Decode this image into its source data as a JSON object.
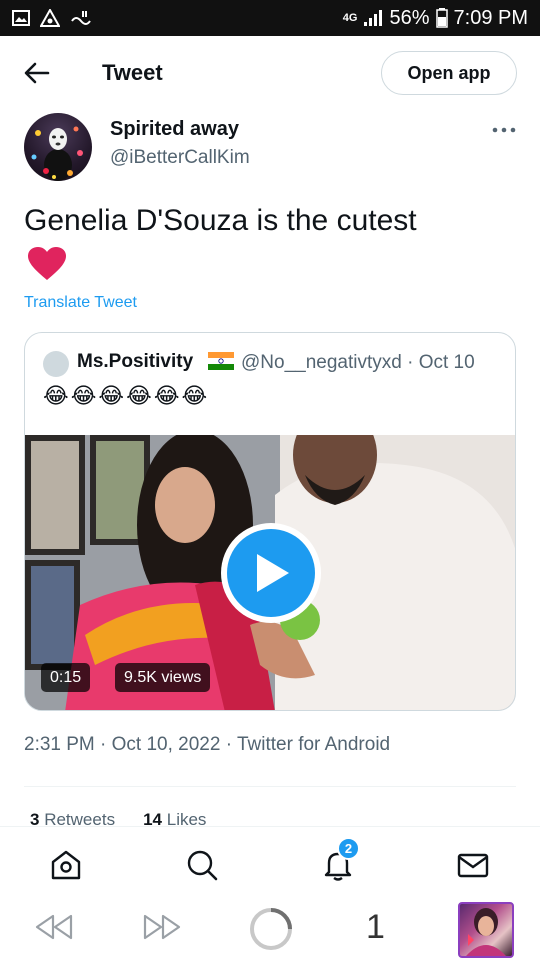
{
  "status_bar": {
    "network": "4G",
    "battery": "56%",
    "time": "7:09 PM"
  },
  "header": {
    "title": "Tweet",
    "open_app_label": "Open app"
  },
  "author": {
    "name": "Spirited away",
    "handle": "@iBetterCallKim"
  },
  "tweet": {
    "text": "Genelia D'Souza is the cutest",
    "emoji": "❤️",
    "translate_label": "Translate Tweet",
    "timestamp": "2:31 PM · Oct 10, 2022 · Twitter for Android"
  },
  "quote": {
    "name": "Ms.Positivity",
    "handle_date": "@No__negativtyxd · Oct 10",
    "text": "😂😂😂😂😂😂",
    "video": {
      "duration": "0:15",
      "views": "9.5K views"
    }
  },
  "stats": {
    "retweets_count": "3",
    "retweets_label": "Retweets",
    "likes_count": "14",
    "likes_label": "Likes"
  },
  "bottom_nav": {
    "notifications_badge": "2"
  },
  "browser_bar": {
    "tab_count": "1"
  },
  "colors": {
    "accent": "#1d9bf0",
    "text_primary": "#0f1419",
    "text_secondary": "#536471",
    "heart": "#e0245e"
  }
}
